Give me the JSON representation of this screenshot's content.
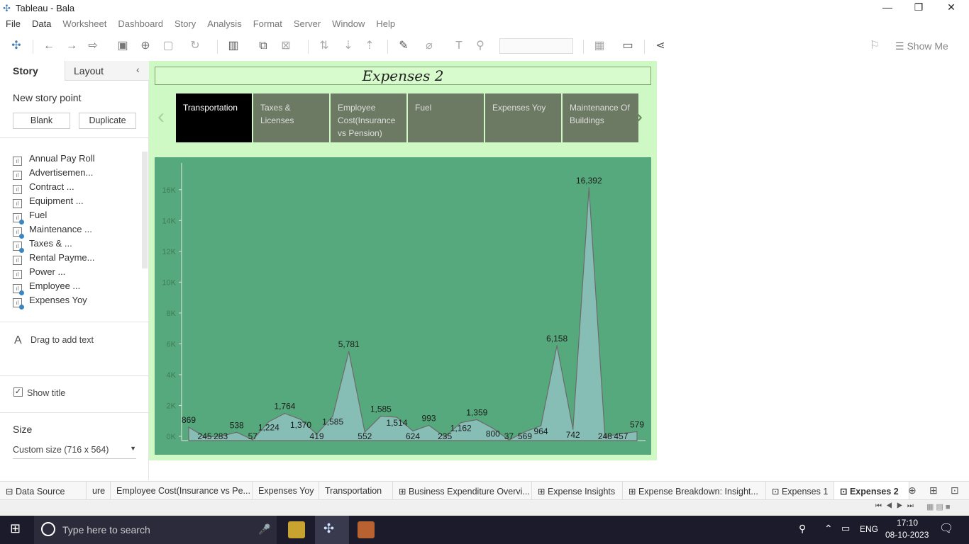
{
  "window": {
    "title": "Tableau - Bala"
  },
  "menu": [
    "File",
    "Data",
    "Worksheet",
    "Dashboard",
    "Story",
    "Analysis",
    "Format",
    "Server",
    "Window",
    "Help"
  ],
  "toolbar": {
    "show_me": "Show Me"
  },
  "left": {
    "tab_story": "Story",
    "tab_layout": "Layout",
    "new_story_point": "New story point",
    "blank": "Blank",
    "duplicate": "Duplicate",
    "sheets": [
      "Annual Pay Roll",
      "Advertisemen...",
      "Contract ...",
      "Equipment ...",
      "Fuel",
      "Maintenance ...",
      "Taxes & ...",
      "Rental Payme...",
      "Power ...",
      "Employee ...",
      "Expenses Yoy"
    ],
    "sheets_checked": [
      false,
      false,
      false,
      false,
      true,
      true,
      true,
      false,
      false,
      true,
      true
    ],
    "drag_text": "Drag to add text",
    "show_title": "Show title",
    "size_label": "Size",
    "size_value": "Custom size (716 x 564)"
  },
  "story": {
    "title": "Expenses 2",
    "points": [
      "Transportation",
      "Taxes & Licenses",
      "Employee Cost(Insurance vs Pension)",
      "Fuel",
      "Expenses Yoy",
      "Maintenance Of Buildings"
    ],
    "active": 0
  },
  "chart_data": {
    "type": "area",
    "yticks": [
      "0K",
      "2K",
      "4K",
      "6K",
      "8K",
      "10K",
      "12K",
      "14K",
      "16K"
    ],
    "ylim": [
      0,
      17000
    ],
    "values": [
      869,
      245,
      283,
      538,
      57,
      1224,
      1764,
      1370,
      419,
      1585,
      5781,
      552,
      1585,
      1514,
      624,
      993,
      235,
      1162,
      1359,
      800,
      37,
      569,
      964,
      6158,
      742,
      16392,
      248,
      457,
      579
    ],
    "labels": [
      "869",
      "245",
      "283",
      "538",
      "57",
      "1,224",
      "1,764",
      "1,370",
      "419",
      "1,585",
      "5,781",
      "552",
      "1,585",
      "1,514",
      "624",
      "993",
      "235",
      "1,162",
      "1,359",
      "800",
      "37",
      "569",
      "964",
      "6,158",
      "742",
      "16,392",
      "248",
      "457",
      "579"
    ],
    "fill": "#86bdb4",
    "line": "#6b6b6b"
  },
  "bottom_tabs": [
    "Data Source",
    "ure",
    "Employee Cost(Insurance vs Pe...",
    "Expenses Yoy",
    "Transportation",
    "Business Expenditure Overvi...",
    "Expense Insights",
    "Expense Breakdown: Insight...",
    "Expenses 1",
    "Expenses 2"
  ],
  "taskbar": {
    "search": "Type here to search",
    "time": "17:10",
    "date": "08-10-2023",
    "lang": "ENG"
  }
}
